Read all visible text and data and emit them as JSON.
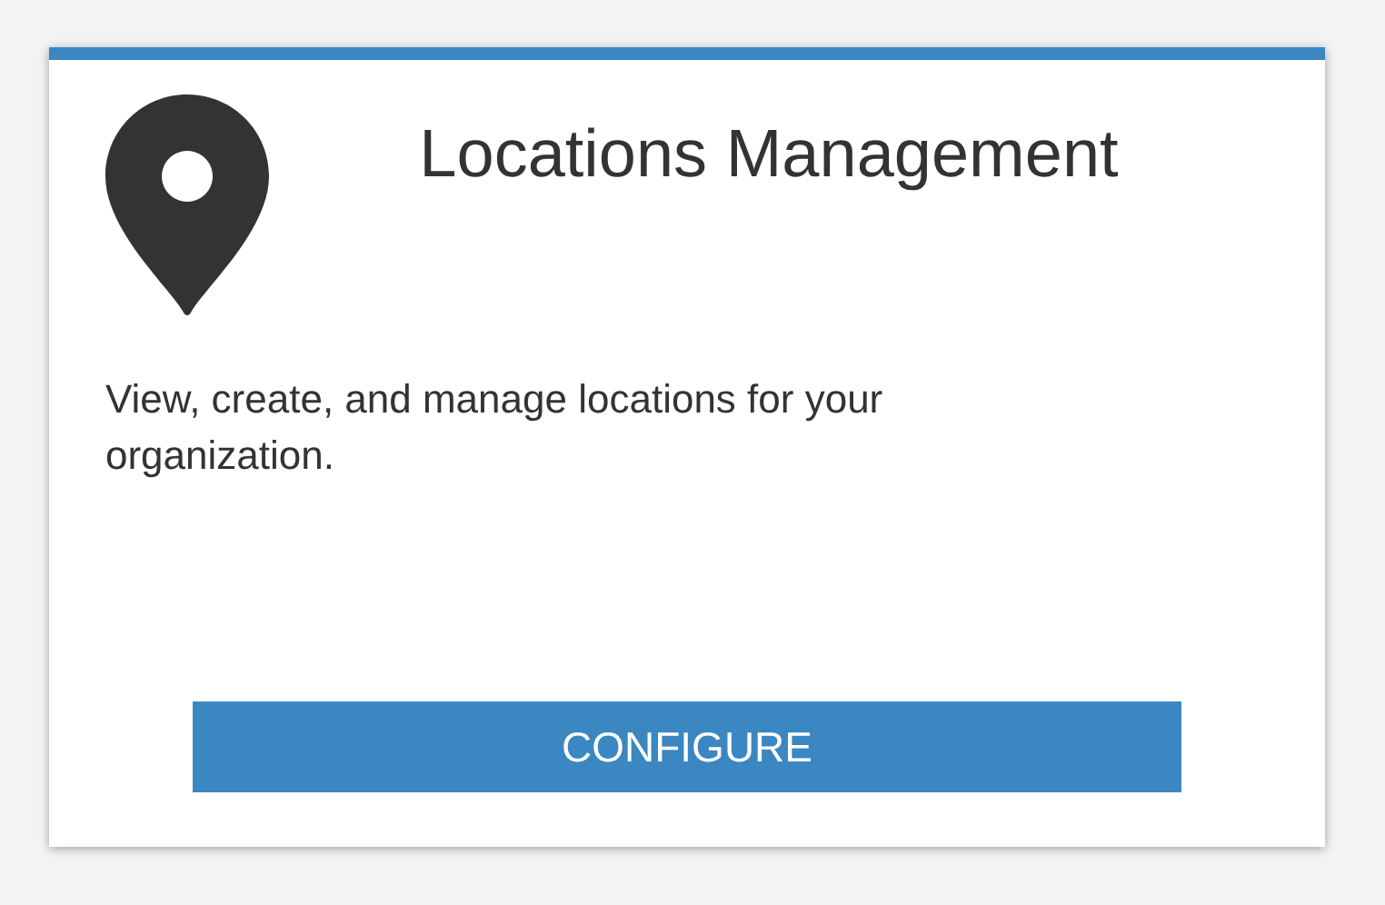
{
  "card": {
    "title": "Locations Management",
    "description": "View, create, and manage locations for your organization.",
    "button": "CONFIGURE"
  }
}
